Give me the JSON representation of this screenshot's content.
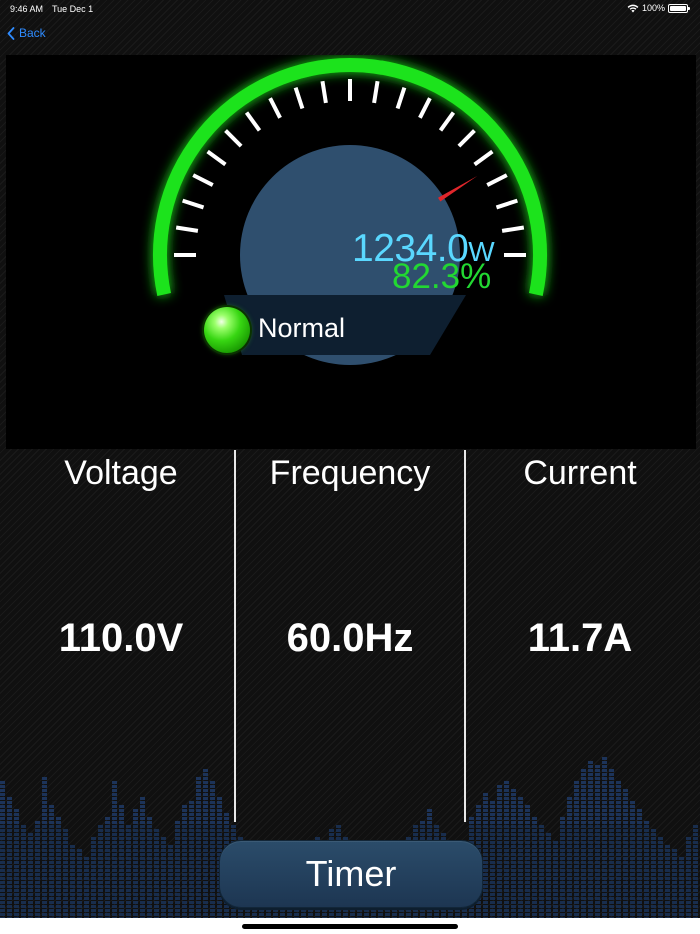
{
  "status_bar": {
    "time": "9:46 AM",
    "date": "Tue Dec 1",
    "battery_text": "100%",
    "battery_level": 1.0,
    "icons": [
      "wifi-icon",
      "battery-icon"
    ]
  },
  "nav": {
    "back_label": "Back",
    "back_icon": "chevron-left-icon"
  },
  "gauge": {
    "power_value": "1234.0",
    "power_unit": "W",
    "percent": "82.3%",
    "status": "Normal",
    "status_color": "#33cc14",
    "needle_level": 0.823,
    "arc_color": "#1ee31a",
    "readout_color": "#5ad8ff",
    "needle_color": "#e0262b"
  },
  "metrics": [
    {
      "label": "Voltage",
      "value": "110.0V"
    },
    {
      "label": "Frequency",
      "value": "60.0Hz"
    },
    {
      "label": "Current",
      "value": "11.7A"
    }
  ],
  "timer": {
    "label": "Timer"
  }
}
